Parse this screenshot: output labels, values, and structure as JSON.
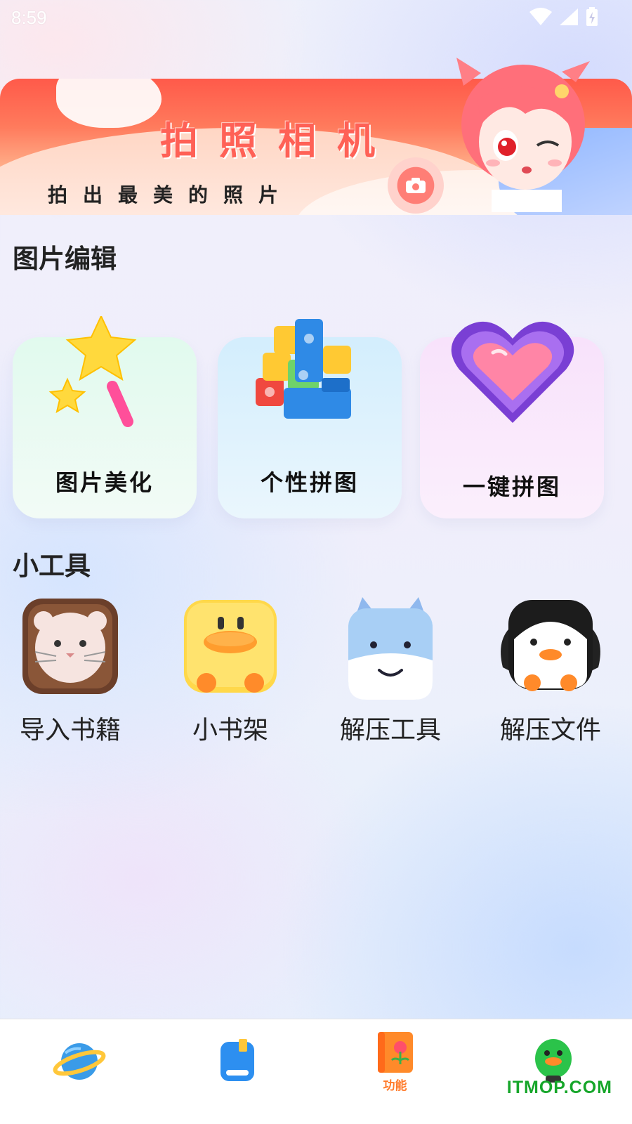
{
  "status_bar": {
    "time": "8:59"
  },
  "banner": {
    "title": "拍照相机",
    "subtitle": "拍出最美的照片"
  },
  "photo_edit": {
    "title": "图片编辑",
    "cards": [
      {
        "label": "图片美化",
        "icon": "magic-wand-star-icon",
        "color": "#e6f9ee"
      },
      {
        "label": "个性拼图",
        "icon": "building-blocks-icon",
        "color": "#dcf1fd"
      },
      {
        "label": "一键拼图",
        "icon": "heart-icon",
        "color": "#f9e6fb"
      }
    ]
  },
  "tools": {
    "title": "小工具",
    "items": [
      {
        "label": "导入书籍",
        "icon": "cat-face-icon"
      },
      {
        "label": "小书架",
        "icon": "duck-face-icon"
      },
      {
        "label": "解压工具",
        "icon": "cow-face-icon"
      },
      {
        "label": "解压文件",
        "icon": "penguin-icon"
      }
    ]
  },
  "bottom_nav": {
    "items": [
      {
        "icon": "planet-icon",
        "label": ""
      },
      {
        "icon": "book-icon",
        "label": ""
      },
      {
        "icon": "flower-book-icon",
        "label": "功能",
        "active": true
      },
      {
        "icon": "green-bird-icon",
        "label": ""
      }
    ]
  },
  "watermark": "ITMOP.COM"
}
